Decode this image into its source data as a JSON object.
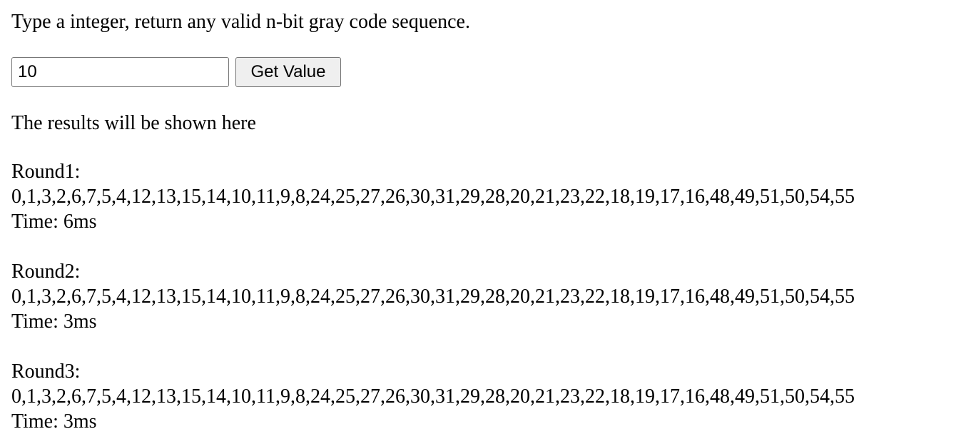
{
  "prompt": "Type a integer, return any valid n-bit gray code sequence.",
  "input": {
    "value": "10"
  },
  "button": {
    "label": "Get Value"
  },
  "results_label": "The results will be shown here",
  "rounds": [
    {
      "label": "Round1:",
      "sequence": "0,1,3,2,6,7,5,4,12,13,15,14,10,11,9,8,24,25,27,26,30,31,29,28,20,21,23,22,18,19,17,16,48,49,51,50,54,55",
      "time": "Time: 6ms"
    },
    {
      "label": "Round2:",
      "sequence": "0,1,3,2,6,7,5,4,12,13,15,14,10,11,9,8,24,25,27,26,30,31,29,28,20,21,23,22,18,19,17,16,48,49,51,50,54,55",
      "time": "Time: 3ms"
    },
    {
      "label": "Round3:",
      "sequence": "0,1,3,2,6,7,5,4,12,13,15,14,10,11,9,8,24,25,27,26,30,31,29,28,20,21,23,22,18,19,17,16,48,49,51,50,54,55",
      "time": "Time: 3ms"
    }
  ]
}
